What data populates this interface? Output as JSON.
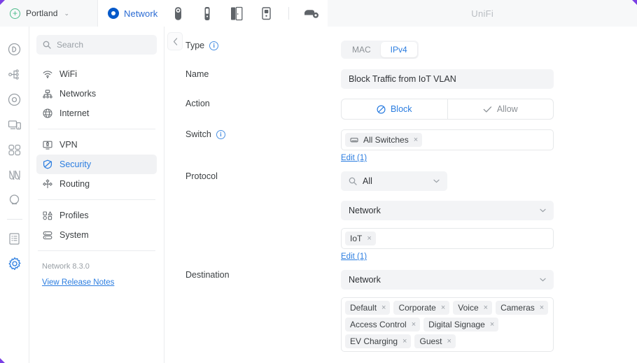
{
  "topbar": {
    "site": {
      "name": "Portland",
      "icon": "plus-circle-icon",
      "caret": "⌄"
    },
    "active_app": {
      "label": "Network",
      "icon": "network-circle-icon"
    },
    "apps": [
      {
        "name": "protect-app-icon"
      },
      {
        "name": "talk-app-icon"
      },
      {
        "name": "access-app-icon"
      },
      {
        "name": "connect-app-icon"
      },
      {
        "name": "drive-app-icon"
      }
    ],
    "title": "UniFi"
  },
  "rail": {
    "items": [
      {
        "name": "dashboard-icon"
      },
      {
        "name": "topology-icon"
      },
      {
        "name": "devices-icon"
      },
      {
        "name": "client-devices-icon"
      },
      {
        "name": "users-icon"
      },
      {
        "name": "insights-icon"
      },
      {
        "name": "hotspot-icon"
      },
      {
        "name": "logs-icon"
      },
      {
        "name": "settings-icon"
      }
    ],
    "active_index": 8
  },
  "nav": {
    "search": {
      "placeholder": "Search",
      "icon": "search-icon"
    },
    "groups": [
      {
        "items": [
          {
            "label": "WiFi",
            "icon": "wifi-icon"
          },
          {
            "label": "Networks",
            "icon": "networks-icon"
          },
          {
            "label": "Internet",
            "icon": "globe-icon"
          }
        ]
      },
      {
        "items": [
          {
            "label": "VPN",
            "icon": "vpn-icon"
          },
          {
            "label": "Security",
            "icon": "shield-icon",
            "active": true
          },
          {
            "label": "Routing",
            "icon": "routing-icon"
          }
        ]
      },
      {
        "items": [
          {
            "label": "Profiles",
            "icon": "profiles-icon"
          },
          {
            "label": "System",
            "icon": "system-icon"
          }
        ]
      }
    ],
    "version": "Network 8.3.0",
    "release_notes": "View Release Notes"
  },
  "form": {
    "back_icon": "chevron-left-icon",
    "type": {
      "label": "Type",
      "info_icon": "info-icon",
      "options": [
        "MAC",
        "IPv4"
      ],
      "selected": "IPv4"
    },
    "name": {
      "label": "Name",
      "value": "Block Traffic from IoT VLAN"
    },
    "action": {
      "label": "Action",
      "options": [
        {
          "label": "Block",
          "icon": "block-icon",
          "selected": true
        },
        {
          "label": "Allow",
          "icon": "check-icon",
          "selected": false
        }
      ]
    },
    "switch": {
      "label": "Switch",
      "info_icon": "info-icon",
      "chips": [
        {
          "label": "All Switches",
          "icon": "switch-icon"
        }
      ],
      "edit_link": "Edit (1)"
    },
    "protocol": {
      "label": "Protocol",
      "value": "All",
      "search_icon": "search-icon",
      "chevron_icon": "chevron-down-icon"
    },
    "source": {
      "type_value": "Network",
      "chevron_icon": "chevron-down-icon",
      "chips": [
        {
          "label": "IoT"
        }
      ],
      "edit_link": "Edit (1)"
    },
    "destination": {
      "label": "Destination",
      "type_value": "Network",
      "chevron_icon": "chevron-down-icon",
      "chips": [
        {
          "label": "Default"
        },
        {
          "label": "Corporate"
        },
        {
          "label": "Voice"
        },
        {
          "label": "Cameras"
        },
        {
          "label": "Access Control"
        },
        {
          "label": "Digital Signage"
        },
        {
          "label": "EV Charging"
        },
        {
          "label": "Guest"
        }
      ]
    }
  },
  "colors": {
    "accent": "#2b7de0",
    "brand_blue": "#0559c9",
    "site_green": "#4cbb8a",
    "corner_purple": "#7b3fe4"
  }
}
